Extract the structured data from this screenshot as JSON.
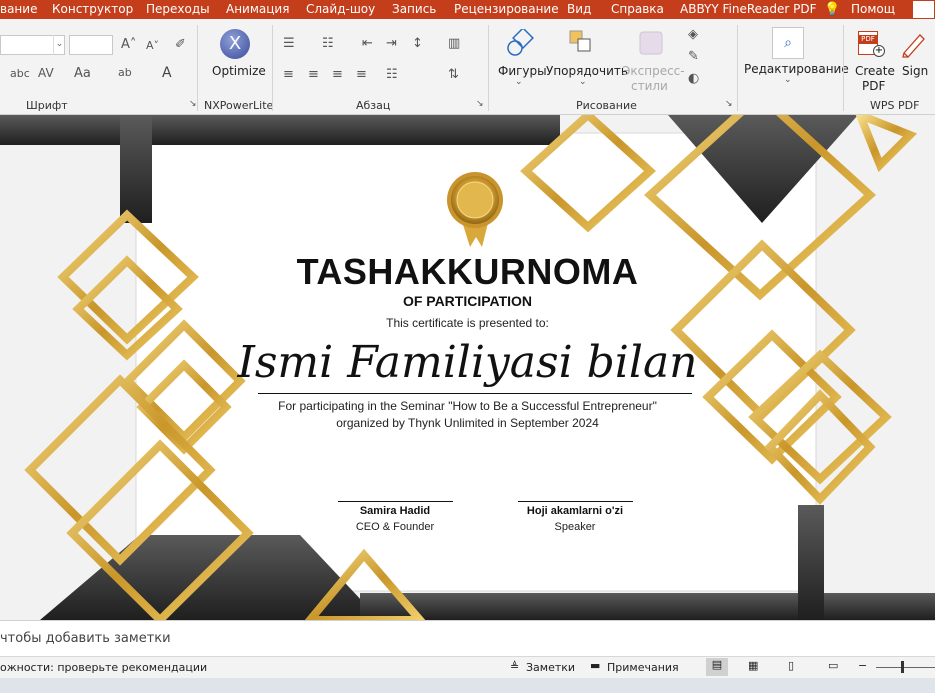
{
  "tabs": [
    "вание",
    "Конструктор",
    "Переходы",
    "Анимация",
    "Слайд-шоу",
    "Запись",
    "Рецензирование",
    "Вид",
    "Справка",
    "ABBYY FineReader PDF",
    "Помощ"
  ],
  "ribbon": {
    "font_group": "Шрифт",
    "nxpower_group": "NXPowerLite",
    "optimize_label": "Optimize",
    "paragraph_group": "Абзац",
    "drawing_group": "Рисование",
    "shapes_label": "Фигуры",
    "arrange_label": "Упорядочить",
    "express_label_1": "Экспресс-",
    "express_label_2": "стили",
    "editing_label": "Редактирование",
    "create_pdf_label_1": "Create",
    "create_pdf_label_2": "PDF",
    "sign_label": "Sign",
    "wps_group": "WPS PDF",
    "pdf_badge": "PDF"
  },
  "certificate": {
    "title": "TASHAKKURNOMA",
    "subtitle": "OF PARTICIPATION",
    "presented": "This certificate is presented to:",
    "name": "Ismi Familiyasi bilan",
    "line1": "For participating in the Seminar \"How to Be a Successful Entrepreneur\"",
    "line2": "organized by Thynk Unlimited in September 2024",
    "sig1_name": "Samira Hadid",
    "sig1_role": "CEO & Founder",
    "sig2_name": "Hoji akamlarni o'zi",
    "sig2_role": "Speaker"
  },
  "notes_placeholder": "чтобы добавить заметки",
  "status": {
    "accessibility": "ожности: проверьте рекомендации",
    "notes_btn": "Заметки",
    "comments_btn": "Примечания"
  },
  "colors": {
    "ribbon_tab_bg": "#c43e1c",
    "gold": "#d4a531",
    "dark": "#2b2b2b"
  }
}
